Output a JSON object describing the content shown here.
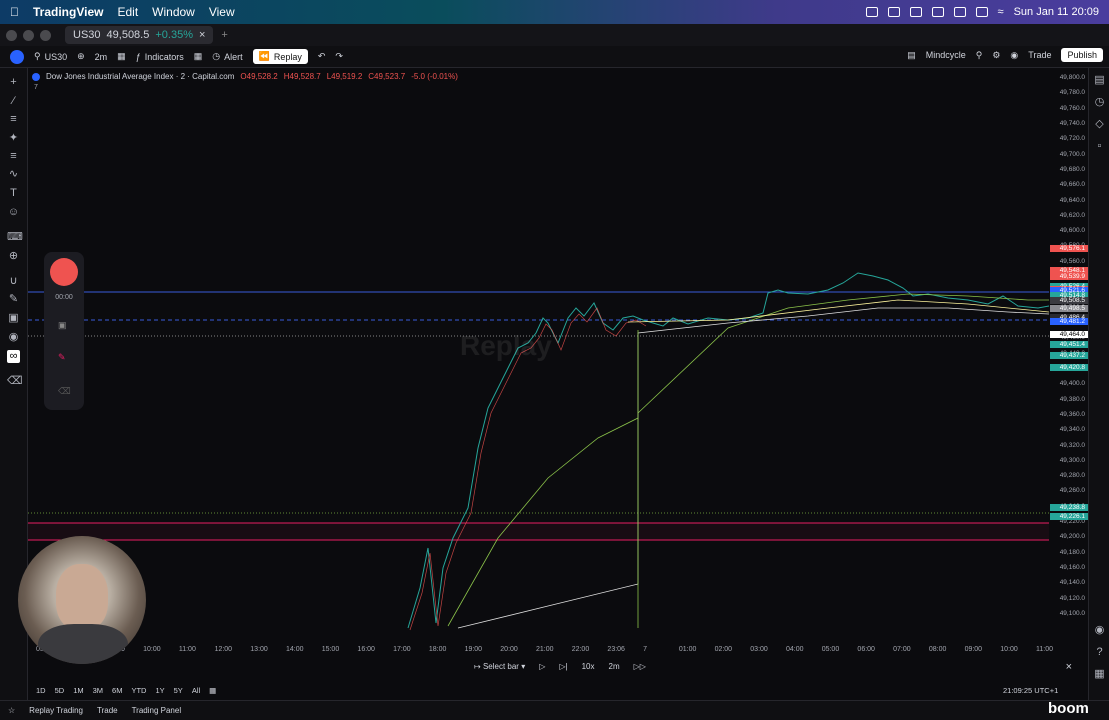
{
  "menubar": {
    "app": "TradingView",
    "items": [
      "Edit",
      "Window",
      "View"
    ],
    "clock": "Sun Jan 11  20:09"
  },
  "tab": {
    "symbol": "US30",
    "price": "49,508.5",
    "change": "+0.35%"
  },
  "toolbar": {
    "search_value": "US30",
    "interval": "2m",
    "indicators_label": "Indicators",
    "alert_label": "Alert",
    "replay_label": "Replay",
    "layout_name": "Mindcycle",
    "trade_label": "Trade",
    "publish_label": "Publish"
  },
  "legend": {
    "title": "Dow Jones Industrial Average Index · 2 · Capital.com",
    "o": "O49,528.2",
    "h": "H49,528.7",
    "l": "L49,519.2",
    "c": "C49,523.7",
    "chg": "-5.0 (-0.01%)",
    "count": "7"
  },
  "price_axis": {
    "ticks": [
      "49,800.0",
      "49,780.0",
      "49,760.0",
      "49,740.0",
      "49,720.0",
      "49,700.0",
      "49,680.0",
      "49,660.0",
      "49,640.0",
      "49,620.0",
      "49,600.0",
      "49,580.0",
      "49,560.0",
      "49,540.0",
      "49,520.0",
      "49,500.0",
      "49,480.0",
      "49,460.0",
      "49,440.0",
      "49,420.0",
      "49,400.0",
      "49,380.0",
      "49,360.0",
      "49,340.0",
      "49,320.0",
      "49,300.0",
      "49,280.0",
      "49,260.0",
      "49,240.0",
      "49,220.0",
      "49,200.0",
      "49,180.0",
      "49,160.0",
      "49,140.0",
      "49,120.0",
      "49,100.0"
    ],
    "tags": [
      {
        "text": "49,576.1",
        "color": "#ef5350"
      },
      {
        "text": "49,548.1",
        "color": "#ef5350"
      },
      {
        "text": "49,539.9",
        "color": "#ef5350"
      },
      {
        "text": "49,526.4",
        "color": "#26a69a"
      },
      {
        "text": "49,523.7",
        "color": "#ef5350"
      },
      {
        "text": "49,521.6",
        "color": "#2962ff"
      },
      {
        "text": "49,514.8",
        "color": "#26a69a"
      },
      {
        "text": "49,508.5",
        "color": "#3a3a40"
      },
      {
        "text": "49,498.5",
        "color": "#8a8a90"
      },
      {
        "text": "49,486.4",
        "color": "#2a2a30"
      },
      {
        "text": "49,481.2",
        "color": "#2962ff"
      },
      {
        "text": "49,464.0",
        "color": "#ffffff"
      },
      {
        "text": "49,451.4",
        "color": "#26a69a"
      },
      {
        "text": "49,437.2",
        "color": "#26a69a"
      },
      {
        "text": "49,420.8",
        "color": "#26a69a"
      },
      {
        "text": "49,238.8",
        "color": "#26a69a"
      },
      {
        "text": "49,226.1",
        "color": "#26a69a"
      }
    ]
  },
  "time_axis": [
    "05:00",
    "08:00",
    "09:00",
    "10:00",
    "11:00",
    "12:00",
    "13:00",
    "14:00",
    "15:00",
    "16:00",
    "17:00",
    "18:00",
    "19:00",
    "20:00",
    "21:00",
    "22:00",
    "23:06",
    "7",
    "01:00",
    "02:00",
    "03:00",
    "04:00",
    "05:00",
    "06:00",
    "07:00",
    "08:00",
    "09:00",
    "10:00",
    "11:00"
  ],
  "replay": {
    "timer": "00:00",
    "select_bar": "Select bar",
    "speed": "10x",
    "interval": "2m",
    "watermark": "Replay"
  },
  "range_buttons": [
    "1D",
    "5D",
    "1M",
    "3M",
    "6M",
    "YTD",
    "1Y",
    "5Y",
    "All"
  ],
  "clock_bottom": "21:09:25 UTC+1",
  "footer": {
    "items": [
      "Replay Trading",
      "Trade",
      "Trading Panel"
    ]
  },
  "brand": "boom"
}
